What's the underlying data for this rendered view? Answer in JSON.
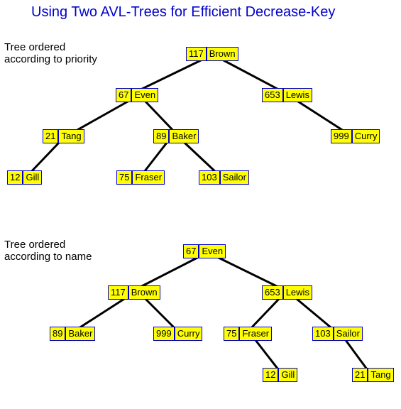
{
  "title": "Using Two AVL-Trees for Efficient Decrease-Key",
  "captions": {
    "priority": "Tree ordered\naccording to priority",
    "name": "Tree ordered\naccording to name"
  },
  "trees": {
    "priority": {
      "root": {
        "key": 117,
        "val": "Brown"
      },
      "l": {
        "key": 67,
        "val": "Even"
      },
      "r": {
        "key": 653,
        "val": "Lewis"
      },
      "ll": {
        "key": 21,
        "val": "Tang"
      },
      "lr": {
        "key": 89,
        "val": "Baker"
      },
      "rr": {
        "key": 999,
        "val": "Curry"
      },
      "lll": {
        "key": 12,
        "val": "Gill"
      },
      "lrl": {
        "key": 75,
        "val": "Fraser"
      },
      "lrr": {
        "key": 103,
        "val": "Sailor"
      }
    },
    "name": {
      "root": {
        "key": 67,
        "val": "Even"
      },
      "l": {
        "key": 117,
        "val": "Brown"
      },
      "r": {
        "key": 653,
        "val": "Lewis"
      },
      "ll": {
        "key": 89,
        "val": "Baker"
      },
      "lr": {
        "key": 999,
        "val": "Curry"
      },
      "rl": {
        "key": 75,
        "val": "Fraser"
      },
      "rr": {
        "key": 103,
        "val": "Sailor"
      },
      "rlr": {
        "key": 12,
        "val": "Gill"
      },
      "rrr": {
        "key": 21,
        "val": "Tang"
      }
    }
  }
}
